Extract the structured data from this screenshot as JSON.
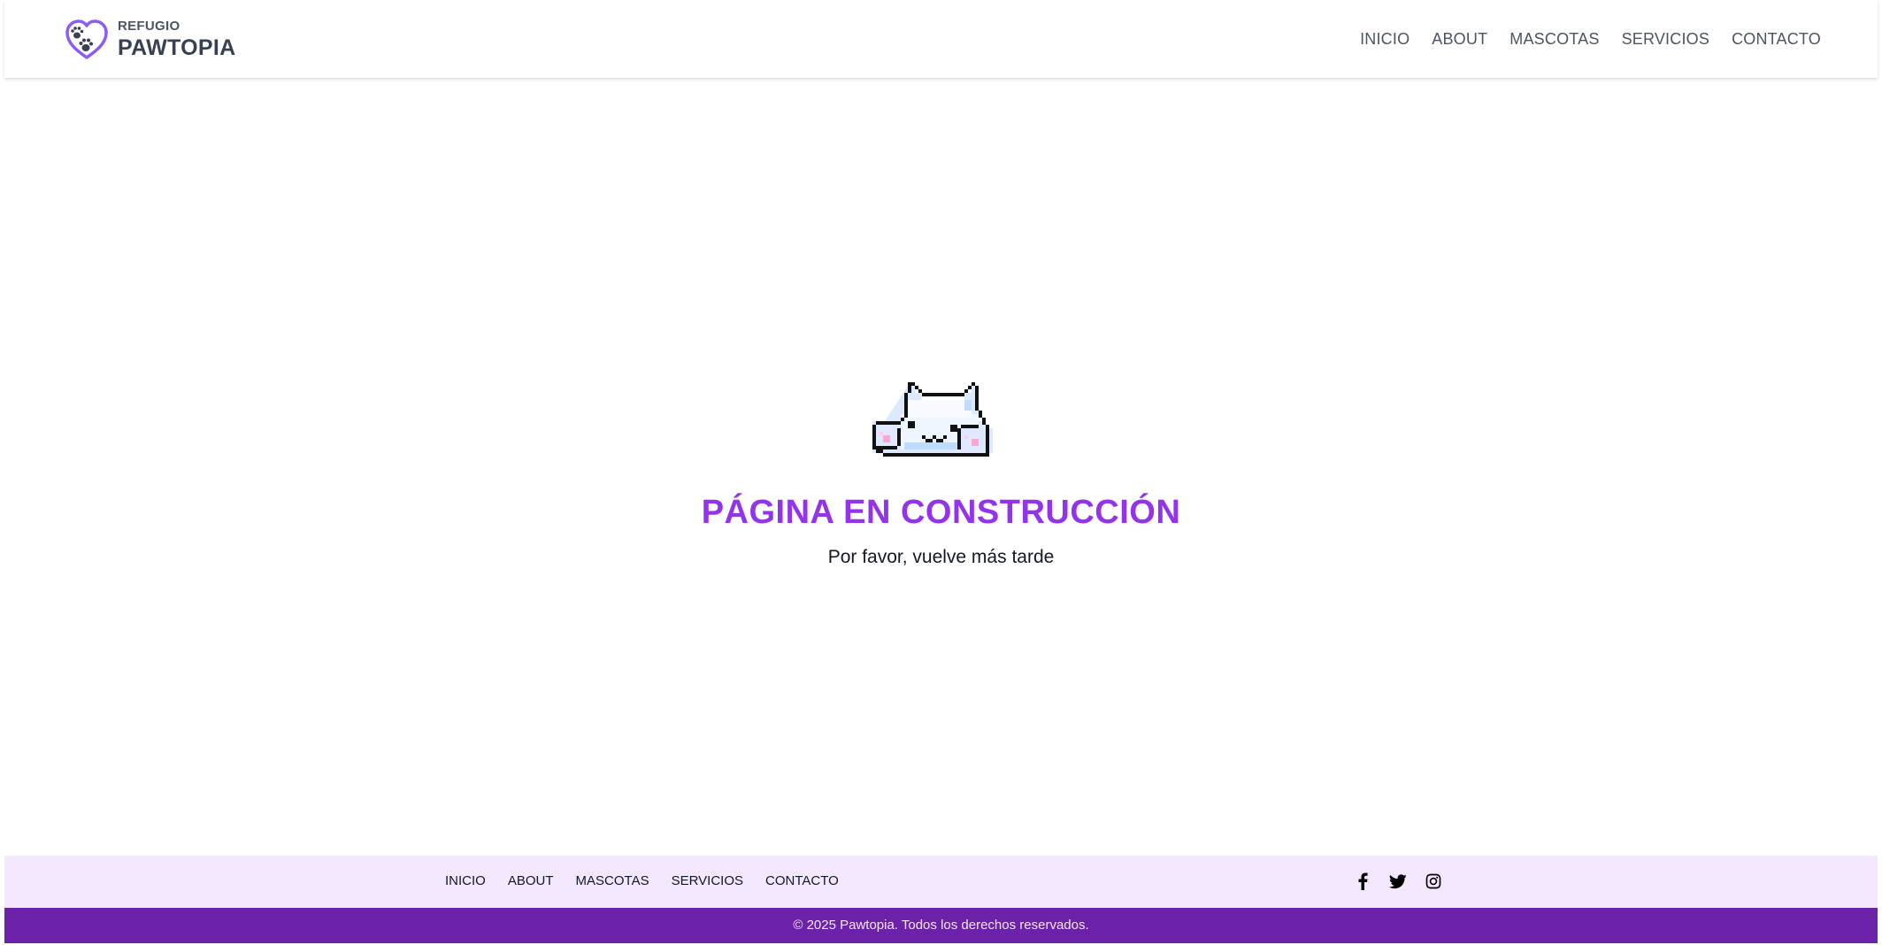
{
  "header": {
    "brand_small": "REFUGIO",
    "brand_big": "PAWTOPIA",
    "nav": [
      "INICIO",
      "ABOUT",
      "MASCOTAS",
      "SERVICIOS",
      "CONTACTO"
    ]
  },
  "main": {
    "title": "PÁGINA EN CONSTRUCCIÓN",
    "subtitle": "Por favor, vuelve más tarde",
    "illustration": "pixel-cat-icon"
  },
  "footer": {
    "nav": [
      "INICIO",
      "ABOUT",
      "MASCOTAS",
      "SERVICIOS",
      "CONTACTO"
    ],
    "social": [
      "facebook-icon",
      "twitter-icon",
      "instagram-icon"
    ],
    "copyright": "© 2025 Pawtopia. Todos los derechos reservados."
  },
  "colors": {
    "accent": "#9333ea",
    "footer_light": "#f3e8ff",
    "footer_dark": "#6b21a8",
    "text_dark": "#374151"
  }
}
